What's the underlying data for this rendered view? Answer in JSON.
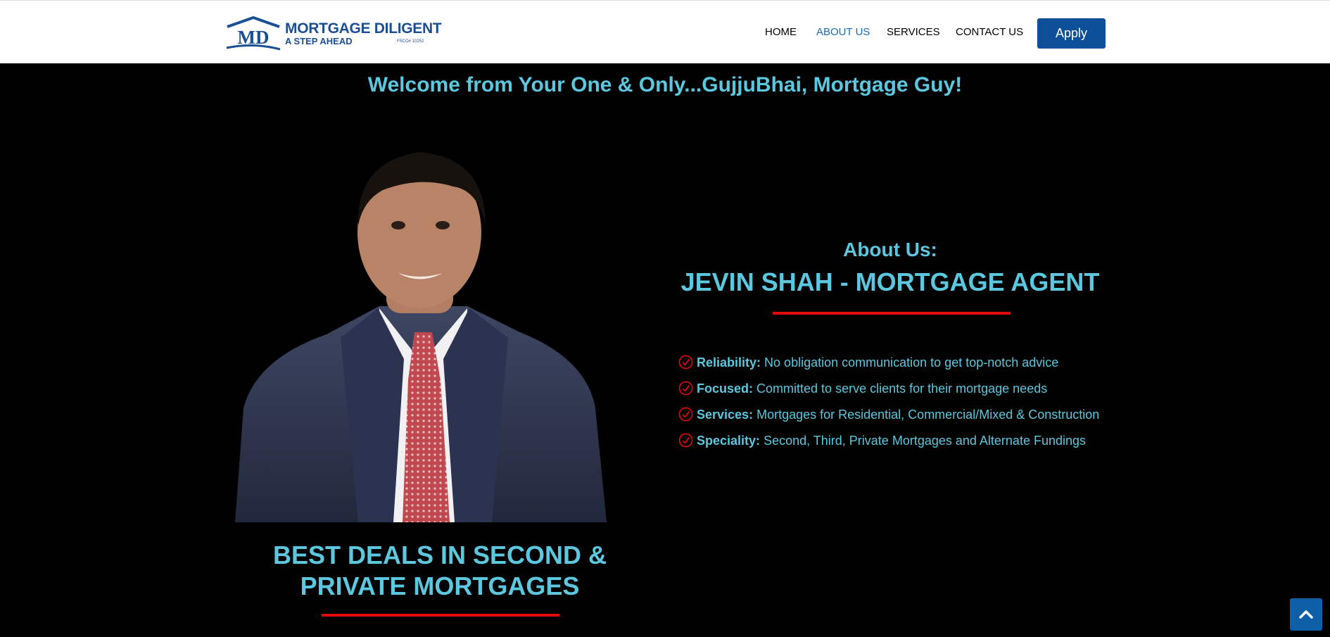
{
  "brand": {
    "monogram": "MD",
    "name": "MORTGAGE DILIGENT",
    "tagline": "A STEP AHEAD",
    "license": "FSCO# 10252"
  },
  "nav": {
    "items": [
      {
        "label": "HOME",
        "active": false
      },
      {
        "label": "ABOUT US",
        "active": true
      },
      {
        "label": "SERVICES",
        "active": false
      },
      {
        "label": "CONTACT US",
        "active": false
      }
    ],
    "apply_label": "Apply"
  },
  "welcome": "Welcome from Your One & Only...GujjuBhai, Mortgage Guy!",
  "deals_title": "BEST DEALS IN SECOND & PRIVATE MORTGAGES",
  "about": {
    "label": "About Us:",
    "name": "JEVIN SHAH - MORTGAGE AGENT",
    "features": [
      {
        "title": "Reliability:",
        "text": "No obligation communication to get top-notch advice"
      },
      {
        "title": "Focused:",
        "text": "Committed to serve clients for their mortgage needs"
      },
      {
        "title": "Services:",
        "text": "Mortgages for Residential, Commercial/Mixed & Construction"
      },
      {
        "title": "Speciality:",
        "text": "Second, Third, Private Mortgages and Alternate Fundings"
      }
    ]
  },
  "icons": {
    "feature_bullet": "check-circle-icon",
    "scroll_top": "chevron-up-icon"
  },
  "colors": {
    "accent_text": "#5bc8df",
    "brand_blue": "#0e4f99",
    "active_nav": "#1c6cb3",
    "divider_red": "#e10b0b",
    "background": "#000000"
  }
}
